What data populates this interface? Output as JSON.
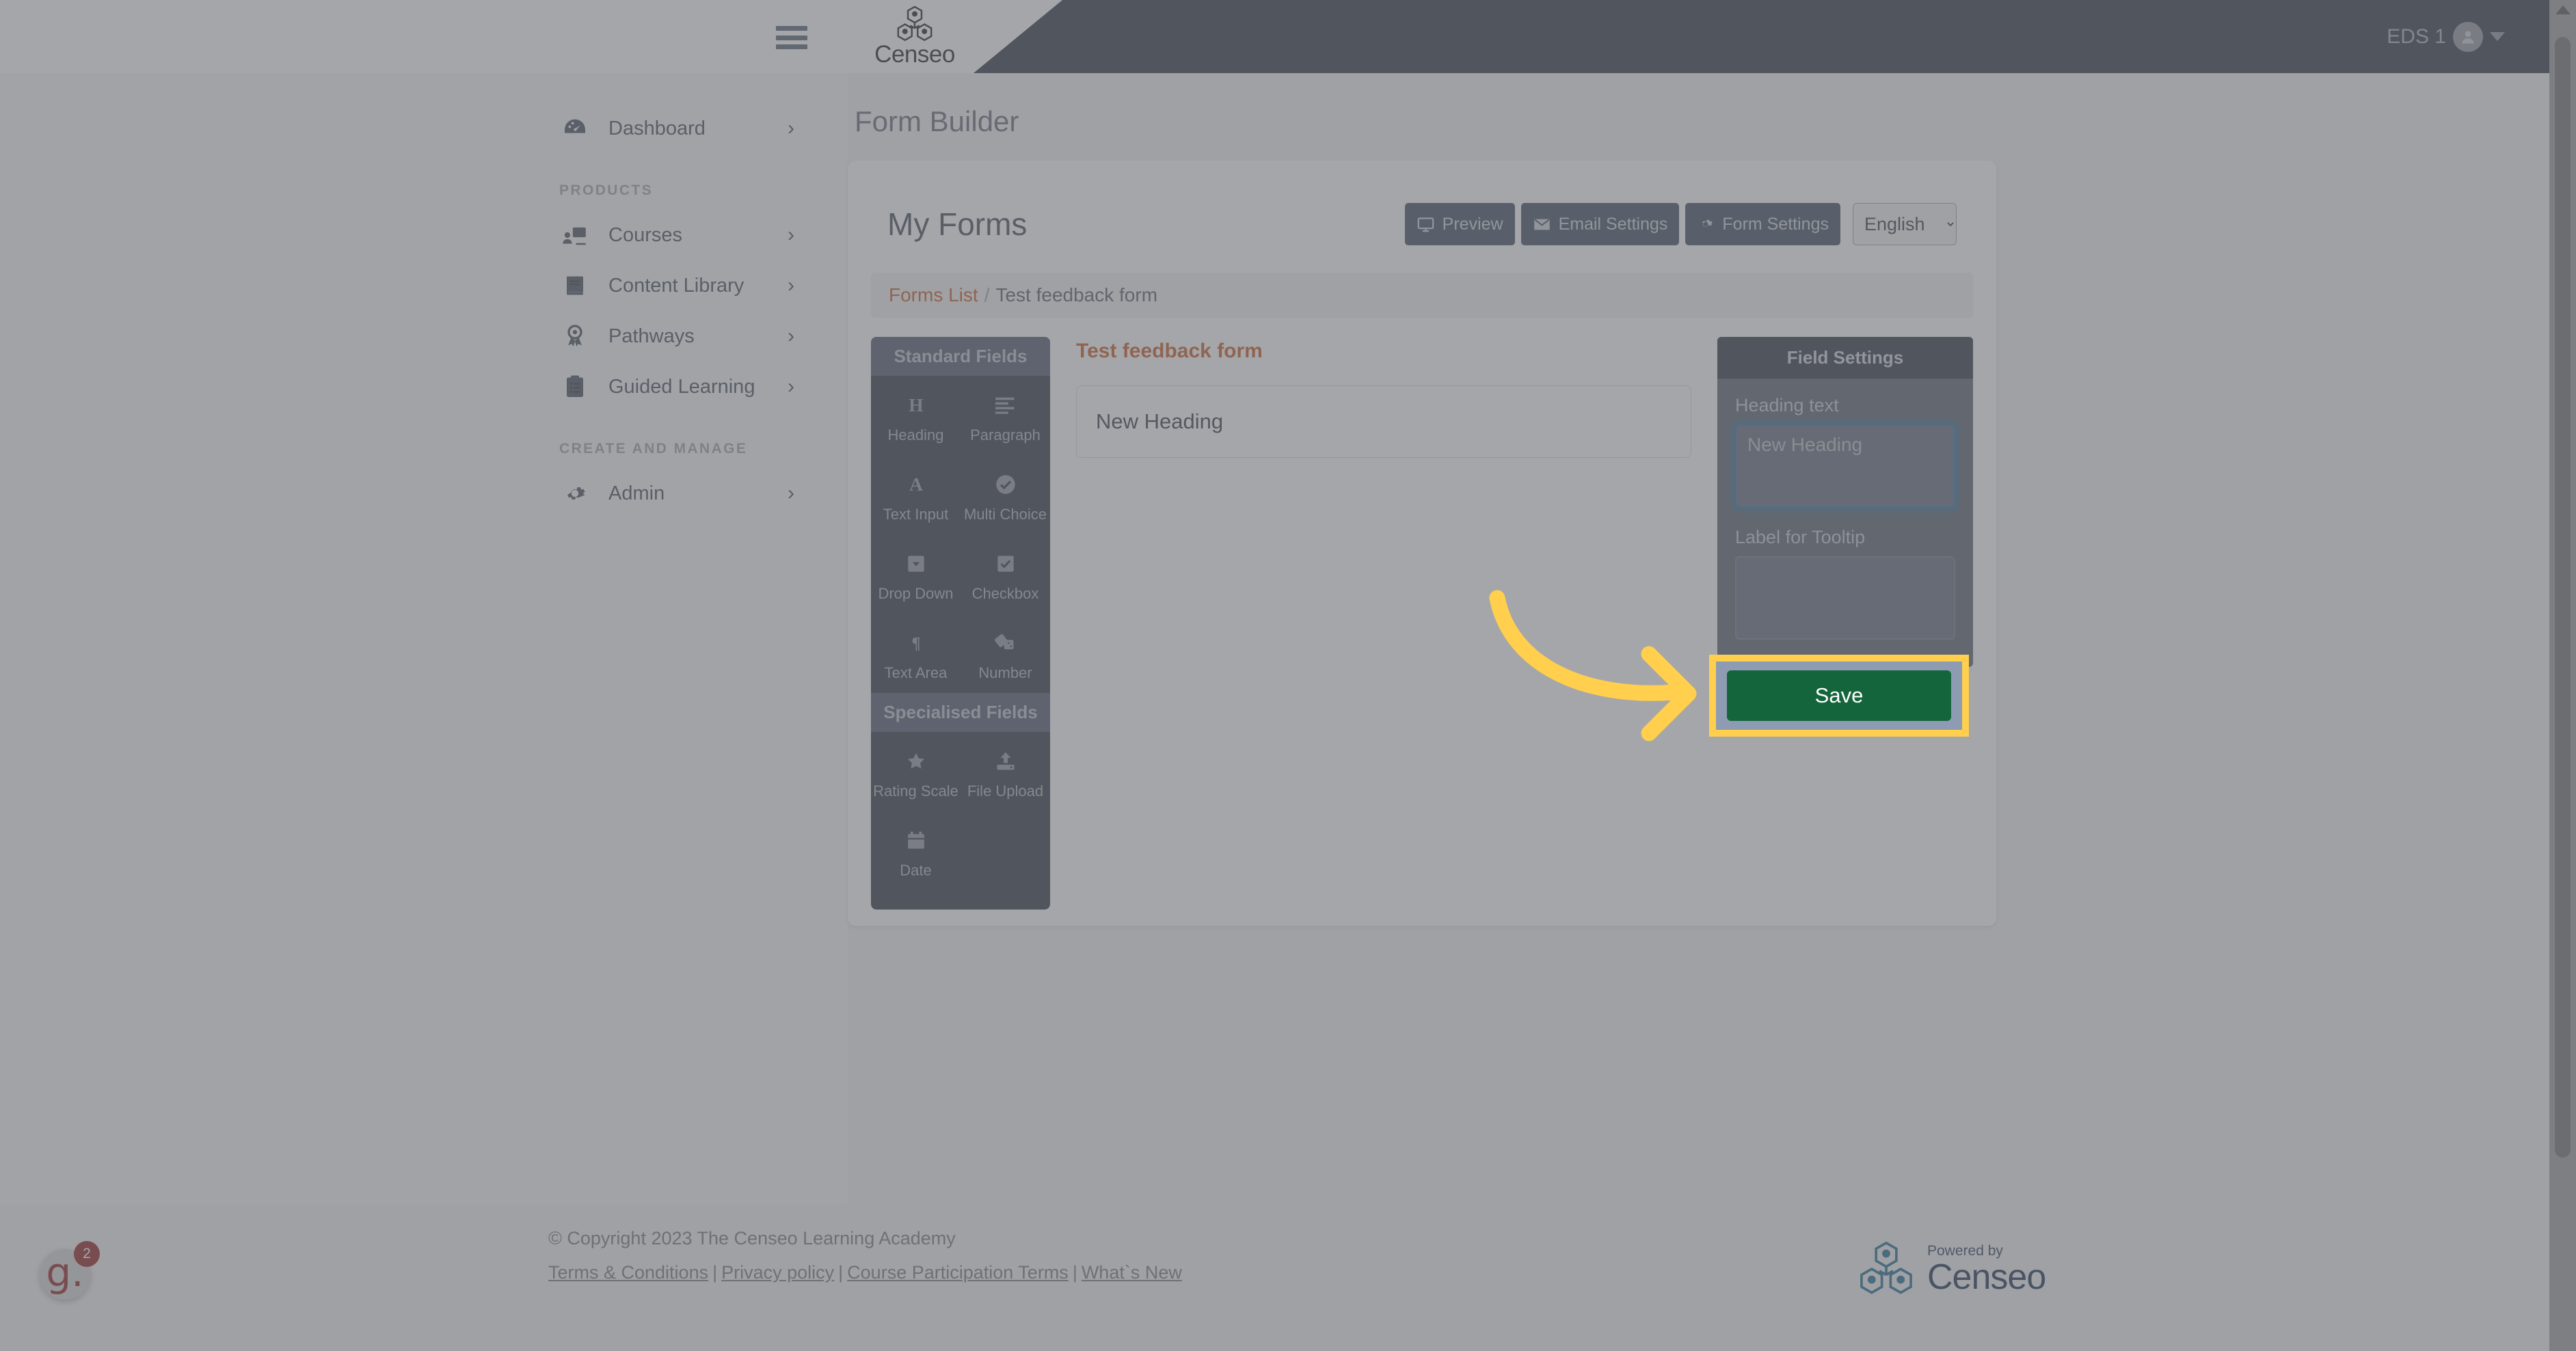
{
  "topbar": {
    "menu_icon": "hamburger-icon",
    "brand": "Censeo",
    "user_name": "EDS 1",
    "avatar_icon": "user-avatar-icon",
    "caret_icon": "caret-down-icon"
  },
  "sidebar": {
    "items": [
      {
        "label": "Dashboard",
        "icon": "dashboard-gauge-icon",
        "chevron": "›"
      }
    ],
    "groups": [
      {
        "title": "PRODUCTS",
        "items": [
          {
            "label": "Courses",
            "icon": "courses-screen-icon",
            "chevron": "›"
          },
          {
            "label": "Content Library",
            "icon": "book-icon",
            "chevron": "›"
          },
          {
            "label": "Pathways",
            "icon": "award-ribbon-icon",
            "chevron": "›"
          },
          {
            "label": "Guided Learning",
            "icon": "clipboard-list-icon",
            "chevron": "›"
          }
        ]
      },
      {
        "title": "CREATE AND MANAGE",
        "items": [
          {
            "label": "Admin",
            "icon": "gear-icon",
            "chevron": "›"
          }
        ]
      }
    ]
  },
  "main": {
    "page_title": "Form Builder",
    "card_title": "My Forms",
    "toolbar": {
      "preview_label": "Preview",
      "email_settings_label": "Email Settings",
      "form_settings_label": "Form Settings",
      "language_selected": "English",
      "language_options": [
        "English"
      ]
    },
    "breadcrumb": {
      "root_label": "Forms List",
      "separator": "/",
      "current_label": "Test feedback form"
    }
  },
  "palette": {
    "sections": [
      {
        "title": "Standard Fields",
        "items": [
          {
            "label": "Heading",
            "icon": "heading-h-icon"
          },
          {
            "label": "Paragraph",
            "icon": "paragraph-lines-icon"
          },
          {
            "label": "Text Input",
            "icon": "text-input-a-icon"
          },
          {
            "label": "Multi Choice",
            "icon": "multi-choice-check-circle-icon"
          },
          {
            "label": "Drop Down",
            "icon": "dropdown-caret-box-icon"
          },
          {
            "label": "Checkbox",
            "icon": "checkbox-icon"
          },
          {
            "label": "Text Area",
            "icon": "text-area-pilcrow-icon"
          },
          {
            "label": "Number",
            "icon": "number-dice-icon"
          }
        ]
      },
      {
        "title": "Specialised Fields",
        "items": [
          {
            "label": "Rating Scale",
            "icon": "star-icon"
          },
          {
            "label": "File Upload",
            "icon": "upload-icon"
          },
          {
            "label": "Date",
            "icon": "calendar-icon"
          }
        ]
      }
    ]
  },
  "canvas": {
    "form_name": "Test feedback form",
    "fields": [
      {
        "type": "heading",
        "text": "New Heading"
      }
    ]
  },
  "field_settings": {
    "title": "Field Settings",
    "heading_text_label": "Heading text",
    "heading_text_value": "New Heading",
    "tooltip_label": "Label for Tooltip",
    "tooltip_value": "",
    "save_label": "Save"
  },
  "footer": {
    "copyright": "© Copyright 2023 The Censeo Learning Academy",
    "links": [
      "Terms & Conditions",
      "Privacy policy",
      "Course Participation Terms",
      "What`s New"
    ],
    "link_separator": "|",
    "powered_small": "Powered by",
    "powered_big": "Censeo"
  },
  "help_widget": {
    "label": "g.",
    "badge": "2"
  },
  "annotation": {
    "arrow_icon": "curved-arrow-right-icon",
    "highlight_color": "#ffcf4d"
  },
  "colors": {
    "accent_orange": "#c4561c",
    "save_green": "#15653c",
    "dark_navy": "#242d3c",
    "panel_slate": "#505a6b",
    "highlight_yellow": "#ffcf4d"
  }
}
